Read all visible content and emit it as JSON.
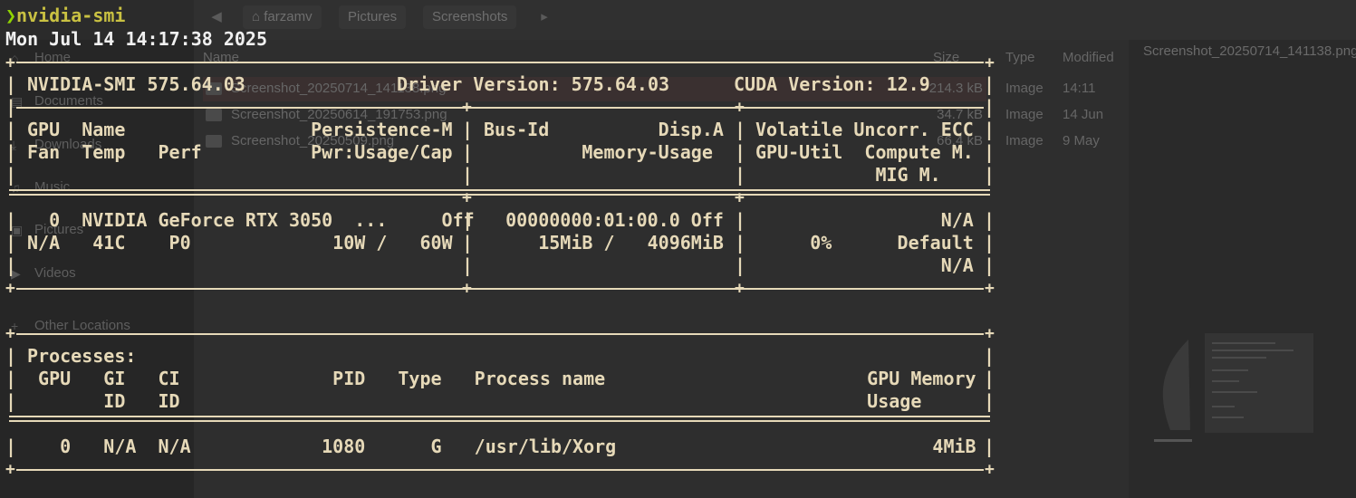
{
  "file_manager": {
    "breadcrumbs": [
      "farzamv",
      "Pictures",
      "Screenshots"
    ],
    "sidebar": [
      "Home",
      "Documents",
      "Downloads",
      "Music",
      "Pictures",
      "Videos",
      "Other Locations"
    ],
    "columns": {
      "name": "Name",
      "size": "Size",
      "type": "Type",
      "modified": "Modified"
    },
    "files": [
      {
        "name": "Screenshot_20250714_141138.png",
        "size": "214.3 kB",
        "type": "Image",
        "modified": "14:11"
      },
      {
        "name": "Screenshot_20250614_191753.png",
        "size": "34.7 kB",
        "type": "Image",
        "modified": "14 Jun"
      },
      {
        "name": "Screenshot_20250509.png",
        "size": "66.4 kB",
        "type": "Image",
        "modified": "9 May"
      }
    ],
    "preview_title": "Screenshot_20250714_141138.png"
  },
  "terminal": {
    "prompt_symbol": "❯",
    "command": "nvidia-smi",
    "timestamp": "Mon Jul 14 14:17:38 2025",
    "header": {
      "smi": "NVIDIA-SMI 575.64.03",
      "driver": "Driver Version: 575.64.03",
      "cuda": "CUDA Version: 12.9"
    },
    "gpu_headers": {
      "c1r1": "GPU  Name                 Persistence-M",
      "c1r2": "Fan  Temp   Perf          Pwr:Usage/Cap",
      "c2r1": "Bus-Id          Disp.A",
      "c2r2": "         Memory-Usage",
      "c3r1": "Volatile Uncorr. ECC",
      "c3r2": "GPU-Util  Compute M.",
      "c3r3": "           MIG M."
    },
    "gpu": {
      "c1r1": "  0  NVIDIA GeForce RTX 3050  ...     Off",
      "c1r2": "N/A   41C    P0             10W /   60W",
      "c2r1": "  00000000:01:00.0 Off",
      "c2r2": "     15MiB /   4096MiB",
      "c3r1": "                 N/A",
      "c3r2": "     0%      Default",
      "c3r3": "                 N/A"
    },
    "processes": {
      "title": "Processes:",
      "h1": " GPU   GI   CI              PID   Type   Process name                        GPU Memory",
      "h2": "       ID   ID                                                               Usage",
      "row": "   0   N/A  N/A            1080      G   /usr/lib/Xorg                             4MiB"
    }
  }
}
